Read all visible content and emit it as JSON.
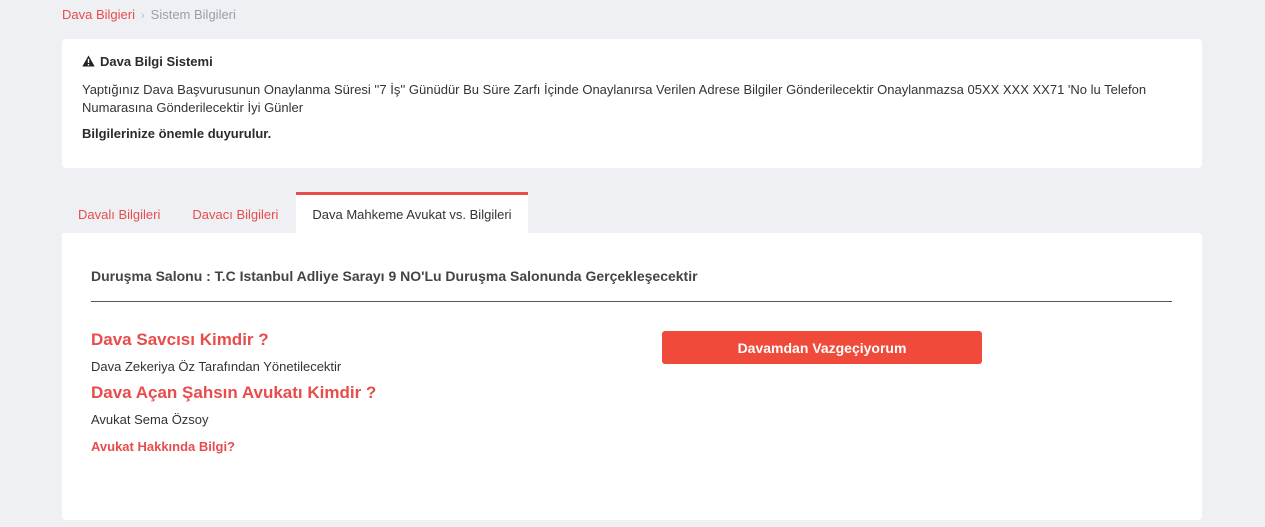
{
  "breadcrumb": {
    "root": "Dava Bilgieri",
    "separator": "›",
    "current": "Sistem Bilgileri"
  },
  "alert": {
    "icon": "warning-icon",
    "title": "Dava Bilgi Sistemi",
    "message": "Yaptığınız Dava Başvurusunun Onaylanma Süresi ''7 İş'' Günüdür Bu Süre Zarfı İçinde Onaylanırsa Verilen Adrese Bilgiler Gönderilecektir Onaylanmazsa 05XX XXX XX71 'No lu Telefon Numarasına Gönderilecektir İyi Günler",
    "footer": "Bilgilerinize önemle duyurulur."
  },
  "tabs": [
    {
      "label": "Davalı Bilgileri",
      "active": false
    },
    {
      "label": "Davacı Bilgileri",
      "active": false
    },
    {
      "label": "Dava Mahkeme Avukat vs. Bilgileri",
      "active": true
    }
  ],
  "main": {
    "court_line": "Duruşma Salonu : T.C Istanbul Adliye Sarayı 9 NO'Lu Duruşma Salonunda Gerçekleşecektir",
    "prosecutor_question": "Dava Savcısı Kimdir ?",
    "prosecutor_answer": "Dava Zekeriya Öz Tarafından Yönetilecektir",
    "lawyer_question": "Dava Açan Şahsın Avukatı Kimdir ?",
    "lawyer_answer": "Avukat Sema Özsoy",
    "lawyer_info_link": "Avukat Hakkında Bilgi?",
    "withdraw_button": "Davamdan Vazgeçiyorum"
  },
  "colors": {
    "accent": "#e84c4c",
    "button": "#f04a3a",
    "background": "#eef0f4"
  }
}
